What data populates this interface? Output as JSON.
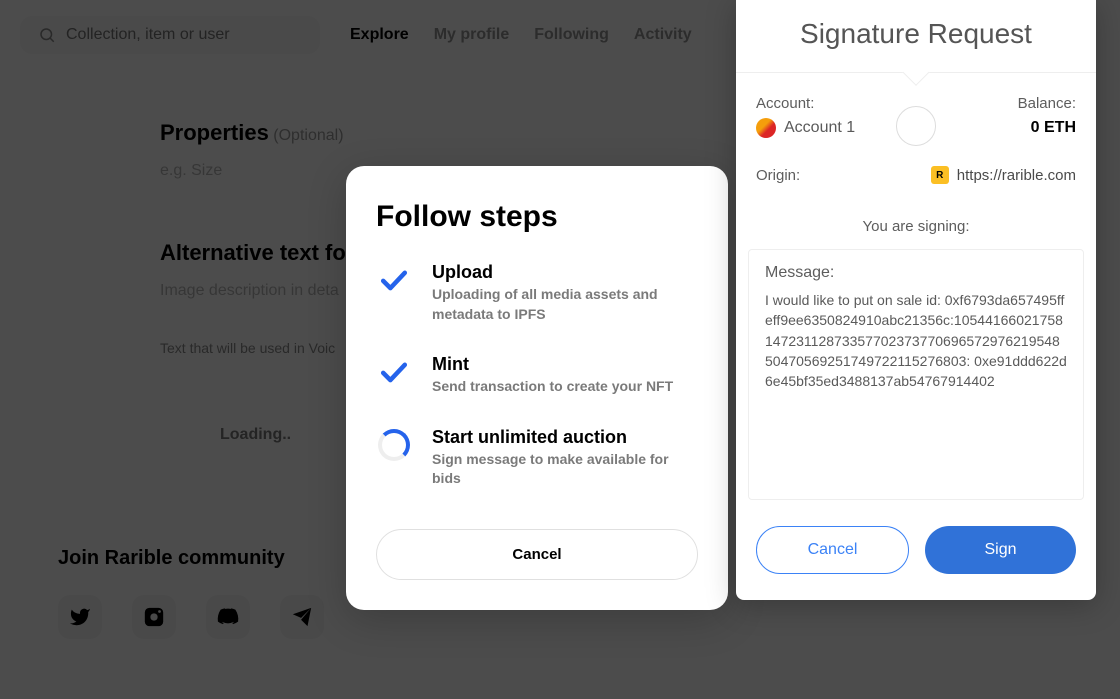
{
  "search": {
    "placeholder": "Collection, item or user"
  },
  "nav": {
    "explore": "Explore",
    "my_profile": "My profile",
    "following": "Following",
    "activity": "Activity"
  },
  "properties": {
    "title": "Properties",
    "optional": "(Optional)",
    "placeholder": "e.g.  Size"
  },
  "alt_text": {
    "title": "Alternative text for NFT",
    "placeholder": "Image description in deta",
    "hint": "Text that will be used in Voic"
  },
  "loading": "Loading..",
  "community": {
    "title": "Join Rarible community"
  },
  "follow_modal": {
    "title": "Follow steps",
    "steps": [
      {
        "title": "Upload",
        "desc": "Uploading of all media assets and metadata to IPFS"
      },
      {
        "title": "Mint",
        "desc": "Send transaction to create your NFT"
      },
      {
        "title": "Start unlimited auction",
        "desc": "Sign message to make available for bids"
      }
    ],
    "cancel": "Cancel"
  },
  "signature": {
    "title": "Signature Request",
    "account_label": "Account:",
    "balance_label": "Balance:",
    "account_name": "Account 1",
    "balance": "0 ETH",
    "origin_label": "Origin:",
    "origin_url": "https://rarible.com",
    "signing_text": "You are signing:",
    "message_label": "Message:",
    "message": "I would like to put on sale id: 0xf6793da657495ffeff9ee6350824910abc21356c:105441660217581472311287335770237377069657297621954850470569251749722115276803: 0xe91ddd622d6e45bf35ed3488137ab54767914402",
    "cancel": "Cancel",
    "sign": "Sign"
  }
}
